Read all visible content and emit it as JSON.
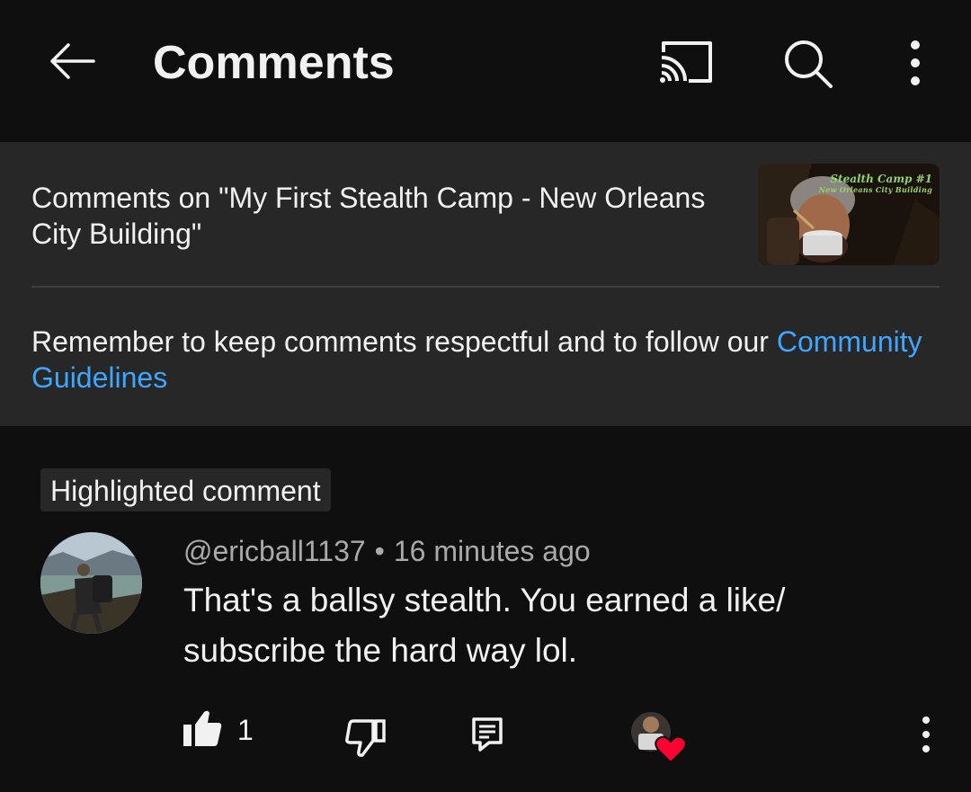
{
  "header": {
    "title": "Comments",
    "icons": [
      "back-arrow-icon",
      "cast-icon",
      "search-icon",
      "more-vert-icon"
    ]
  },
  "video_info": {
    "heading": "Comments on \"My First Stealth Camp - New Orleans City Building\"",
    "thumbnail": {
      "caption_line1": "Stealth Camp #1",
      "caption_line2": "New Orleans City Building"
    }
  },
  "reminder": {
    "text": "Remember to keep comments respectful and to follow our ",
    "link_text": "Community Guidelines"
  },
  "highlighted_badge": "Highlighted comment",
  "comment": {
    "author": "@ericball1137",
    "separator": "•",
    "time": "16 minutes ago",
    "text": "That's a ballsy stealth. You earned a like/ subscribe the hard way lol.",
    "like_count": "1",
    "creator_hearted": true
  },
  "colors": {
    "background": "#0f0f0f",
    "panel": "#272727",
    "text_primary": "#f1f1f1",
    "text_secondary": "#aaaaaa",
    "link": "#3ea6ff",
    "heart": "#ff0033"
  }
}
